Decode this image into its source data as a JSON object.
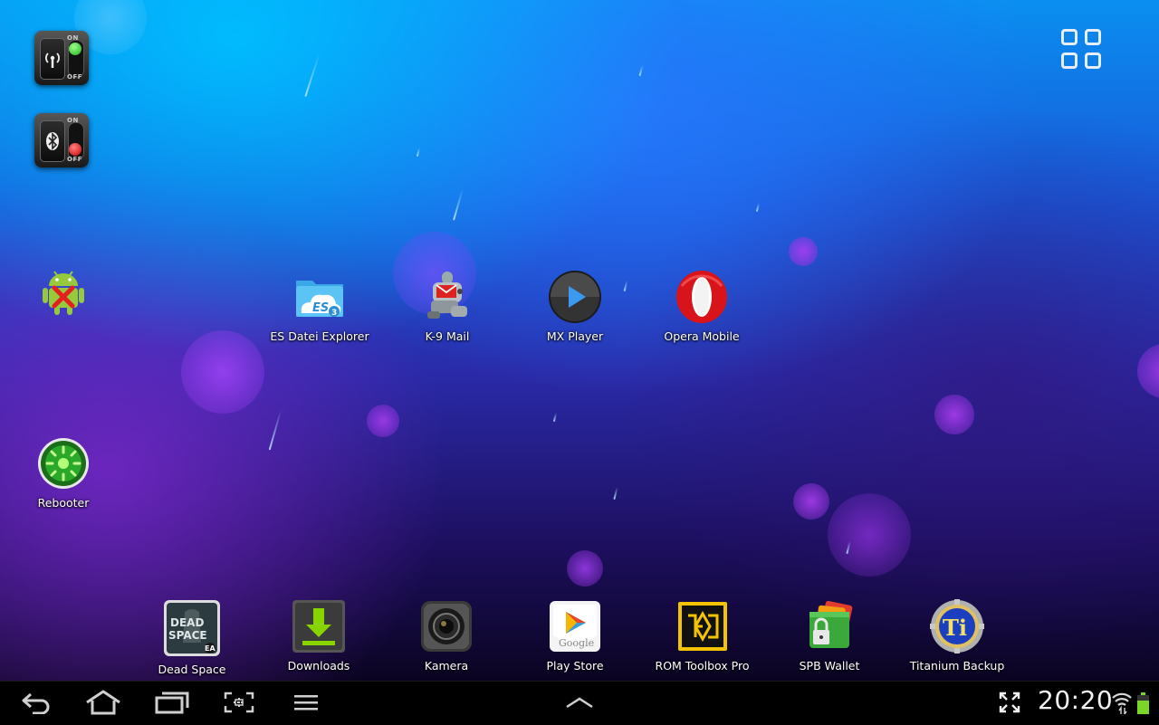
{
  "home": {
    "widgets": [
      {
        "name": "wifi-toggle-widget",
        "on_label": "ON",
        "off_label": "OFF",
        "state": "on",
        "icon": "wifi-antenna-icon",
        "indicator_color": "#2ecc2e"
      },
      {
        "name": "bluetooth-toggle-widget",
        "on_label": "ON",
        "off_label": "OFF",
        "state": "off",
        "icon": "bluetooth-icon",
        "indicator_color": "#e02020"
      }
    ],
    "shortcuts": [
      {
        "label": "",
        "icon": "android-uninstall-icon"
      },
      {
        "label": "Rebooter",
        "icon": "power-restart-icon"
      },
      {
        "label": "ES Datei Explorer",
        "icon": "folder-cloud-icon"
      },
      {
        "label": "K-9 Mail",
        "icon": "robot-dog-mail-icon"
      },
      {
        "label": "MX Player",
        "icon": "play-icon"
      },
      {
        "label": "Opera Mobile",
        "icon": "opera-icon"
      }
    ],
    "apps_button_icon": "all-apps-grid-icon"
  },
  "dock": {
    "items": [
      {
        "label": "Dead Space",
        "icon": "dead-space-icon",
        "art_text_1": "DEAD",
        "art_text_2": "SPACE",
        "art_text_3": "EA"
      },
      {
        "label": "Downloads",
        "icon": "download-arrow-icon"
      },
      {
        "label": "Kamera",
        "icon": "camera-lens-icon"
      },
      {
        "label": "Play Store",
        "icon": "google-play-icon",
        "art_text_1": "Google"
      },
      {
        "label": "ROM Toolbox Pro",
        "icon": "rom-toolbox-icon"
      },
      {
        "label": "SPB Wallet",
        "icon": "wallet-lock-icon"
      },
      {
        "label": "Titanium Backup",
        "icon": "titanium-backup-icon",
        "art_text_1": "Ti"
      }
    ]
  },
  "navbar": {
    "back_icon": "back-arrow-icon",
    "home_icon": "home-icon",
    "recents_icon": "recent-apps-icon",
    "screenshot_icon": "screenshot-icon",
    "menu_icon": "menu-icon",
    "up_icon": "chevron-up-icon",
    "fullscreen_icon": "expand-icon",
    "clock": "20:20",
    "wifi_icon": "wifi-signal-icon",
    "battery_icon": "battery-icon",
    "colors": {
      "battery": "#7bd428",
      "icons": "#cfcfcf"
    }
  }
}
